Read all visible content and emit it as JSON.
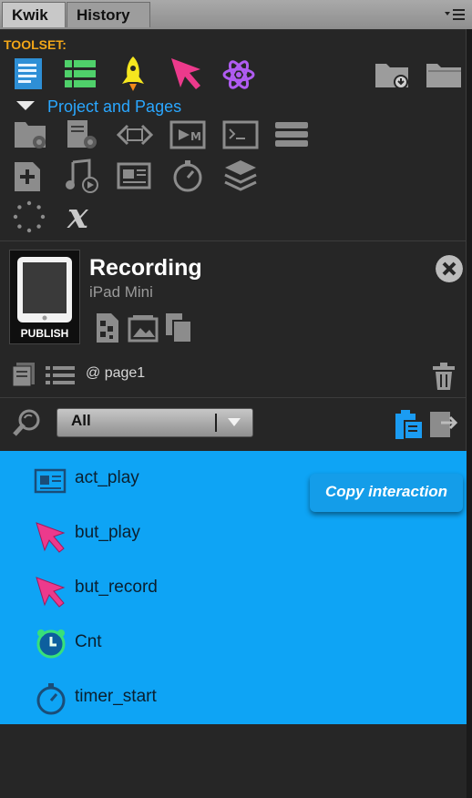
{
  "tabs": [
    {
      "label": "Kwik",
      "active": true
    },
    {
      "label": "History",
      "active": false
    }
  ],
  "toolset": {
    "label": "TOOLSET:",
    "icons": [
      "document-icon",
      "grid-list-icon",
      "rocket-icon",
      "pointer-icon",
      "atom-icon"
    ],
    "right_icons": [
      "folder-download-icon",
      "folder-icon"
    ]
  },
  "project": {
    "section_label": "Project and Pages",
    "row1": [
      "folder-settings-icon",
      "page-settings-icon",
      "code-arrows-icon",
      "film-frame-icon",
      "terminal-icon",
      "server-stack-icon"
    ],
    "row2": [
      "add-page-icon",
      "music-note-icon",
      "image-text-icon",
      "stopwatch-icon",
      "layers-icon"
    ],
    "row3": [
      "dotted-circle-icon",
      "variable-x-icon"
    ]
  },
  "page_info": {
    "title": "Recording",
    "device": "iPad Mini",
    "publish_label": "PUBLISH",
    "page_name": "@ page1"
  },
  "filter": {
    "selected": "All"
  },
  "list": {
    "items": [
      {
        "label": "act_play",
        "icon": "action-icon"
      },
      {
        "label": "but_play",
        "icon": "pointer-icon"
      },
      {
        "label": "but_record",
        "icon": "pointer-icon"
      },
      {
        "label": "Cnt",
        "icon": "timer-green-icon"
      },
      {
        "label": "timer_start",
        "icon": "stopwatch-blue-icon"
      }
    ],
    "copy_label": "Copy interaction"
  },
  "colors": {
    "accent_blue": "#0ea4f5",
    "toolset_orange": "#f2a618",
    "project_blue": "#2aa7ff",
    "pointer_pink": "#ec3a8c"
  }
}
